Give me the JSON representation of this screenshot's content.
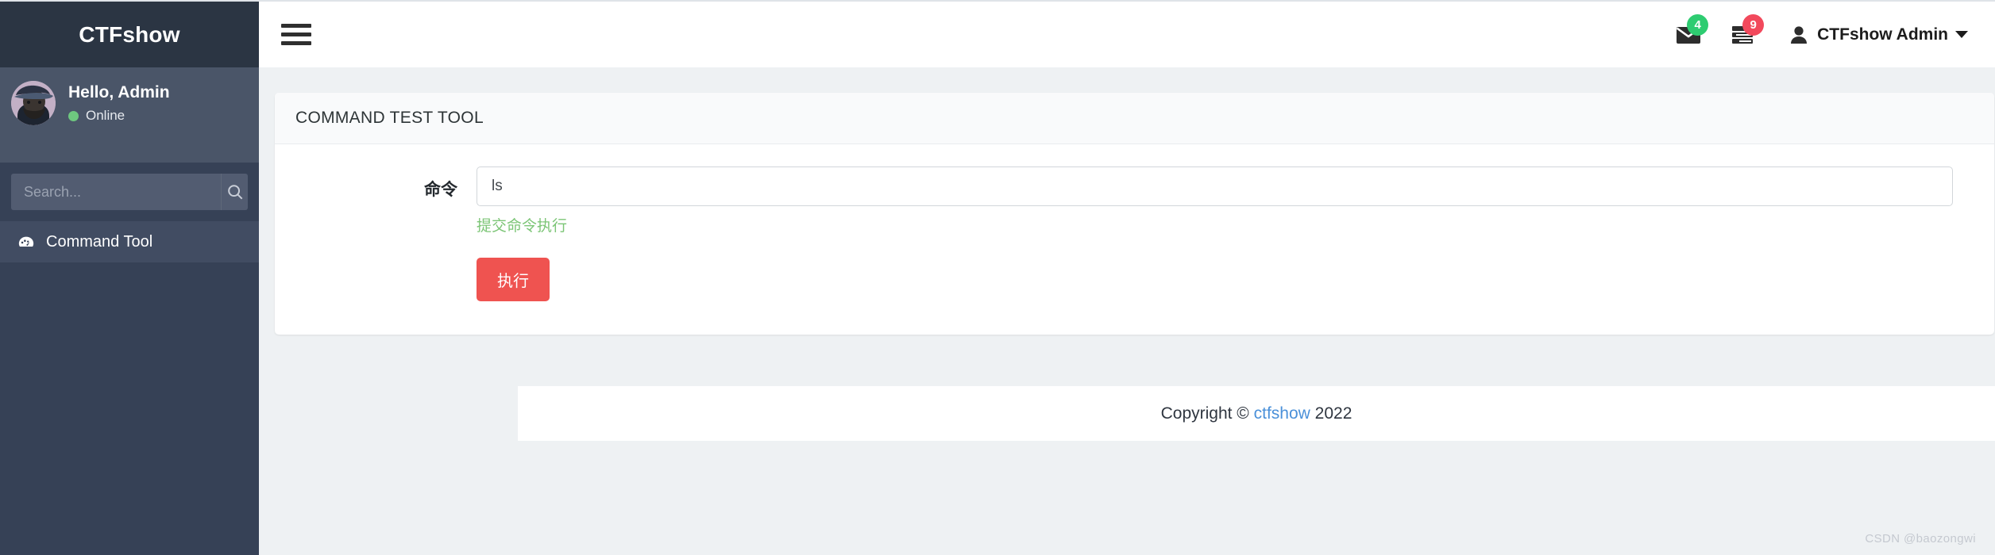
{
  "sidebar": {
    "brand": "CTFshow",
    "user": {
      "greeting": "Hello, Admin",
      "status": "Online",
      "avatar_icon": "user-avatar-image"
    },
    "search": {
      "placeholder": "Search...",
      "value": "",
      "button_icon": "search-icon"
    },
    "nav_items": [
      {
        "label": "Command Tool",
        "icon": "tachometer-icon",
        "active": true
      }
    ]
  },
  "navbar": {
    "menu_toggle_icon": "hamburger-icon",
    "messages": {
      "icon": "envelope-icon",
      "badge": "4",
      "badge_color": "#2ecc71"
    },
    "tasks": {
      "icon": "tasks-list-icon",
      "badge": "9",
      "badge_color": "#f2495c"
    },
    "user_menu": {
      "icon": "user-icon",
      "label": "CTFshow Admin",
      "caret_icon": "caret-down-icon"
    }
  },
  "card": {
    "title": "COMMAND TEST TOOL",
    "form": {
      "label": "命令",
      "input_value": "ls",
      "input_placeholder": "",
      "help_text": "提交命令执行",
      "submit_label": "执行",
      "submit_color": "#ef5350"
    }
  },
  "footer": {
    "prefix": "Copyright © ",
    "link": "ctfshow",
    "suffix": " 2022"
  },
  "watermark": "CSDN @baozongwi"
}
